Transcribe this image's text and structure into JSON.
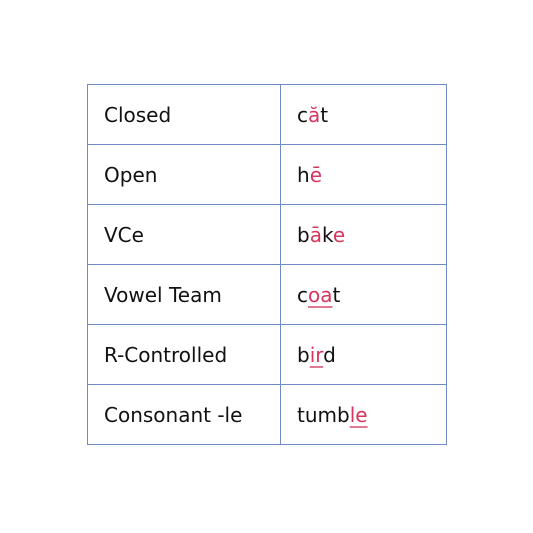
{
  "accent_color": "#d7355d",
  "border_color": "#6f8cc4",
  "rows": [
    {
      "type": "Closed",
      "example": "căt",
      "segments": [
        {
          "text": "c",
          "style": "plain"
        },
        {
          "text": "ă",
          "style": "highlight"
        },
        {
          "text": "t",
          "style": "plain"
        }
      ]
    },
    {
      "type": "Open",
      "example": "hē",
      "segments": [
        {
          "text": "h",
          "style": "plain"
        },
        {
          "text": "ē",
          "style": "highlight"
        }
      ]
    },
    {
      "type": "VCe",
      "example": "bāke",
      "segments": [
        {
          "text": "b",
          "style": "plain"
        },
        {
          "text": "ā",
          "style": "highlight"
        },
        {
          "text": "k",
          "style": "plain"
        },
        {
          "text": "e",
          "style": "highlight"
        }
      ]
    },
    {
      "type": "Vowel Team",
      "example": "coat",
      "segments": [
        {
          "text": "c",
          "style": "plain"
        },
        {
          "text": "oa",
          "style": "underline"
        },
        {
          "text": "t",
          "style": "plain"
        }
      ]
    },
    {
      "type": "R-Controlled",
      "example": "bird",
      "segments": [
        {
          "text": "b",
          "style": "plain"
        },
        {
          "text": "ir",
          "style": "underline"
        },
        {
          "text": "d",
          "style": "plain"
        }
      ]
    },
    {
      "type": "Consonant -le",
      "example": "tumble",
      "segments": [
        {
          "text": "tumb",
          "style": "plain"
        },
        {
          "text": "le",
          "style": "underline"
        }
      ]
    }
  ]
}
